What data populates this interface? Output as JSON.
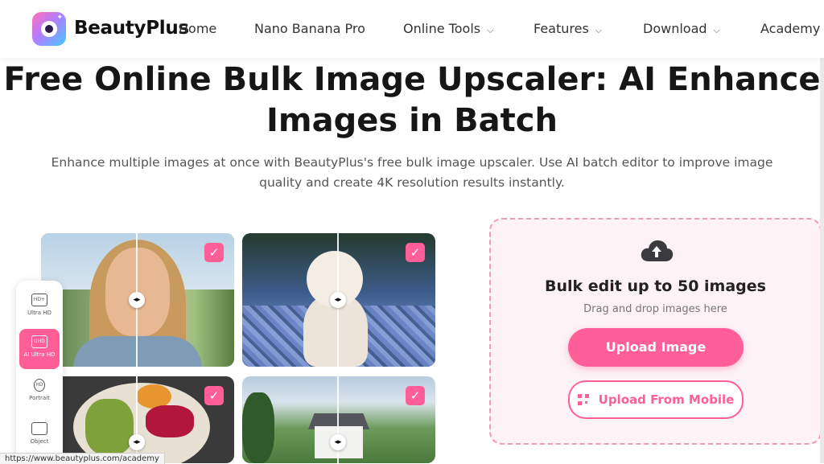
{
  "header": {
    "brand": "BeautyPlus",
    "nav": [
      {
        "label": "Home"
      },
      {
        "label": "Nano Banana Pro"
      },
      {
        "label": "Online Tools",
        "dropdown": true
      },
      {
        "label": "Features",
        "dropdown": true
      },
      {
        "label": "Download",
        "dropdown": true
      },
      {
        "label": "Academy"
      }
    ]
  },
  "hero": {
    "title_line1": "Free Online Bulk Image Upscaler: AI Enhance",
    "title_line2": "Images in Batch",
    "subtitle_line1": "Enhance multiple images at once with BeautyPlus's free bulk image upscaler. Use AI batch editor to improve image",
    "subtitle_line2": "quality and create 4K resolution results instantly."
  },
  "tools": [
    {
      "label": "Ultra HD",
      "icon_text": "HD+"
    },
    {
      "label": "AI Ultra HD",
      "icon_text": "UHD"
    },
    {
      "label": "Portrait",
      "icon_text": "HD"
    },
    {
      "label": "Object",
      "icon_text": ""
    }
  ],
  "upload": {
    "title": "Bulk edit up to 50 images",
    "hint": "Drag and drop images here",
    "upload_button": "Upload Image",
    "mobile_button": "Upload From Mobile"
  },
  "status_bar": {
    "url": "https://www.beautyplus.com/academy"
  },
  "colors": {
    "accent": "#ff5e97",
    "upload_bg": "#fdf2f6",
    "dash_border": "#f29ab9"
  }
}
